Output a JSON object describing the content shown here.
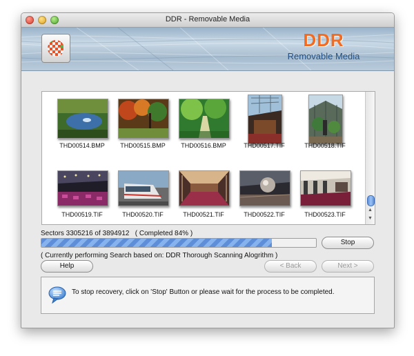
{
  "window": {
    "title": "DDR - Removable Media"
  },
  "banner": {
    "brand": "DDR",
    "subtitle": "Removable Media",
    "logo_icon": "checkered-logo-icon"
  },
  "files": [
    {
      "name": "THD00514.BMP"
    },
    {
      "name": "THD00515.BMP"
    },
    {
      "name": "THD00516.BMP"
    },
    {
      "name": "THD00517.TIF"
    },
    {
      "name": "THD00518.TIF"
    },
    {
      "name": "THD00519.TIF"
    },
    {
      "name": "THD00520.TIF"
    },
    {
      "name": "THD00521.TIF"
    },
    {
      "name": "THD00522.TIF"
    },
    {
      "name": "THD00523.TIF"
    }
  ],
  "progress": {
    "sectors_text": "Sectors 3305216 of 3894912",
    "completed_text": "( Completed 84% )",
    "fraction": 0.84,
    "status_text": "( Currently performing Search based on: DDR Thorough Scanning Alogrithm )"
  },
  "buttons": {
    "stop": "Stop",
    "help": "Help",
    "back": "< Back",
    "next": "Next >"
  },
  "info": {
    "message": "To stop recovery, click on 'Stop' Button or please wait for the process to be completed.",
    "icon": "speech-bubble-icon"
  },
  "colors": {
    "brand_orange": "#f36b21",
    "brand_blue": "#1f4f86",
    "progress_blue": "#5e8ed8"
  }
}
